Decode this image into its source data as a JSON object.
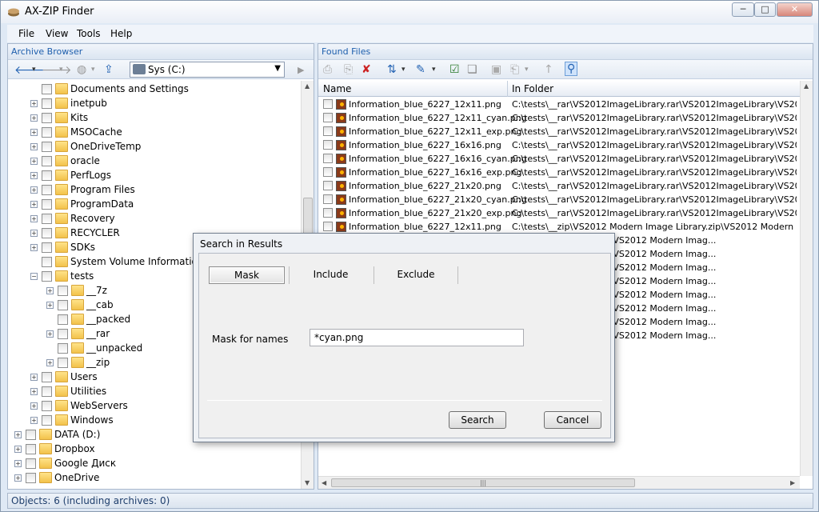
{
  "window": {
    "title": "AX-ZIP Finder",
    "min_glyph": "─",
    "max_glyph": "□",
    "close_glyph": "✕"
  },
  "menu": [
    "File",
    "View",
    "Tools",
    "Help"
  ],
  "left_pane": {
    "header": "Archive Browser",
    "drive": "Sys (C:)",
    "tree": [
      {
        "label": "Documents and Settings",
        "level": 1,
        "expander": false
      },
      {
        "label": "inetpub",
        "level": 1,
        "expander": true
      },
      {
        "label": "Kits",
        "level": 1,
        "expander": true
      },
      {
        "label": "MSOCache",
        "level": 1,
        "expander": true
      },
      {
        "label": "OneDriveTemp",
        "level": 1,
        "expander": true
      },
      {
        "label": "oracle",
        "level": 1,
        "expander": true
      },
      {
        "label": "PerfLogs",
        "level": 1,
        "expander": true
      },
      {
        "label": "Program Files",
        "level": 1,
        "expander": true
      },
      {
        "label": "ProgramData",
        "level": 1,
        "expander": true
      },
      {
        "label": "Recovery",
        "level": 1,
        "expander": true
      },
      {
        "label": "RECYCLER",
        "level": 1,
        "expander": true
      },
      {
        "label": "SDKs",
        "level": 1,
        "expander": true
      },
      {
        "label": "System Volume Information",
        "level": 1,
        "expander": false
      },
      {
        "label": "tests",
        "level": 1,
        "expander": true,
        "expanded": true
      },
      {
        "label": "__7z",
        "level": 2,
        "expander": true
      },
      {
        "label": "__cab",
        "level": 2,
        "expander": true
      },
      {
        "label": "__packed",
        "level": 2,
        "expander": false
      },
      {
        "label": "__rar",
        "level": 2,
        "expander": true
      },
      {
        "label": "__unpacked",
        "level": 2,
        "expander": false
      },
      {
        "label": "__zip",
        "level": 2,
        "expander": true
      },
      {
        "label": "Users",
        "level": 1,
        "expander": true
      },
      {
        "label": "Utilities",
        "level": 1,
        "expander": true
      },
      {
        "label": "WebServers",
        "level": 1,
        "expander": true
      },
      {
        "label": "Windows",
        "level": 1,
        "expander": true
      },
      {
        "label": "DATA (D:)",
        "level": 0,
        "expander": true
      },
      {
        "label": "Dropbox",
        "level": 0,
        "expander": true
      },
      {
        "label": "Google Диск",
        "level": 0,
        "expander": true
      },
      {
        "label": "OneDrive",
        "level": 0,
        "expander": true
      }
    ]
  },
  "right_pane": {
    "header": "Found Files",
    "columns": [
      "Name",
      "In Folder"
    ],
    "files": [
      {
        "name": "Information_blue_6227_12x11.png",
        "folder": "C:\\tests\\__rar\\VS2012ImageLibrary.rar\\VS2012ImageLibrary\\VS2012 M..."
      },
      {
        "name": "Information_blue_6227_12x11_cyan.png",
        "folder": "C:\\tests\\__rar\\VS2012ImageLibrary.rar\\VS2012ImageLibrary\\VS2012 M..."
      },
      {
        "name": "Information_blue_6227_12x11_exp.png",
        "folder": "C:\\tests\\__rar\\VS2012ImageLibrary.rar\\VS2012ImageLibrary\\VS2012 M..."
      },
      {
        "name": "Information_blue_6227_16x16.png",
        "folder": "C:\\tests\\__rar\\VS2012ImageLibrary.rar\\VS2012ImageLibrary\\VS2012 M..."
      },
      {
        "name": "Information_blue_6227_16x16_cyan.png",
        "folder": "C:\\tests\\__rar\\VS2012ImageLibrary.rar\\VS2012ImageLibrary\\VS2012 M..."
      },
      {
        "name": "Information_blue_6227_16x16_exp.png",
        "folder": "C:\\tests\\__rar\\VS2012ImageLibrary.rar\\VS2012ImageLibrary\\VS2012 M..."
      },
      {
        "name": "Information_blue_6227_21x20.png",
        "folder": "C:\\tests\\__rar\\VS2012ImageLibrary.rar\\VS2012ImageLibrary\\VS2012 M..."
      },
      {
        "name": "Information_blue_6227_21x20_cyan.png",
        "folder": "C:\\tests\\__rar\\VS2012ImageLibrary.rar\\VS2012ImageLibrary\\VS2012 M..."
      },
      {
        "name": "Information_blue_6227_21x20_exp.png",
        "folder": "C:\\tests\\__rar\\VS2012ImageLibrary.rar\\VS2012ImageLibrary\\VS2012 M..."
      },
      {
        "name": "Information_blue_6227_12x11.png",
        "folder": "C:\\tests\\__zip\\VS2012 Modern Image Library.zip\\VS2012 Modern Imag..."
      },
      {
        "name": "",
        "folder": "dern Image Library.zip\\VS2012 Modern Imag..."
      },
      {
        "name": "",
        "folder": "dern Image Library.zip\\VS2012 Modern Imag..."
      },
      {
        "name": "",
        "folder": "dern Image Library.zip\\VS2012 Modern Imag..."
      },
      {
        "name": "",
        "folder": "dern Image Library.zip\\VS2012 Modern Imag..."
      },
      {
        "name": "",
        "folder": "dern Image Library.zip\\VS2012 Modern Imag..."
      },
      {
        "name": "",
        "folder": "dern Image Library.zip\\VS2012 Modern Imag..."
      },
      {
        "name": "",
        "folder": "dern Image Library.zip\\VS2012 Modern Imag..."
      },
      {
        "name": "",
        "folder": "dern Image Library.zip\\VS2012 Modern Imag..."
      }
    ]
  },
  "status": "Objects: 6 (including archives: 0)",
  "dialog": {
    "title": "Search in Results",
    "tabs": [
      "Mask",
      "Include",
      "Exclude"
    ],
    "mask_label": "Mask for names",
    "mask_value": "*cyan.png",
    "search_button": "Search",
    "cancel_button": "Cancel"
  },
  "colors": {
    "accent": "#1e5fad",
    "folder": "#f3c24b"
  }
}
